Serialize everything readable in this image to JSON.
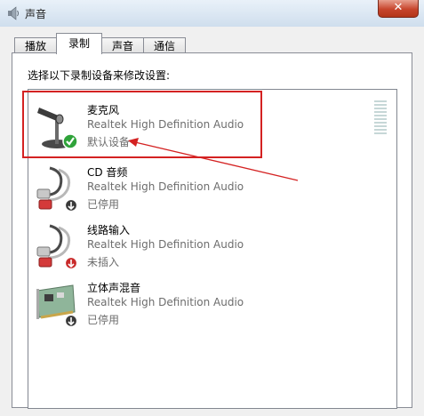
{
  "window": {
    "title": "声音",
    "close_label": "✕"
  },
  "tabs": [
    {
      "label": "播放",
      "active": false
    },
    {
      "label": "录制",
      "active": true
    },
    {
      "label": "声音",
      "active": false
    },
    {
      "label": "通信",
      "active": false
    }
  ],
  "instruction": "选择以下录制设备来修改设置:",
  "devices": [
    {
      "name": "麦克风",
      "driver": "Realtek High Definition Audio",
      "status": "默认设备",
      "icon": "microphone-icon",
      "badge": "default-check-icon"
    },
    {
      "name": "CD 音频",
      "driver": "Realtek High Definition Audio",
      "status": "已停用",
      "icon": "audio-jack-icon",
      "badge": "disabled-arrow-icon"
    },
    {
      "name": "线路输入",
      "driver": "Realtek High Definition Audio",
      "status": "未插入",
      "icon": "audio-jack-icon",
      "badge": "unplugged-arrow-icon"
    },
    {
      "name": "立体声混音",
      "driver": "Realtek High Definition Audio",
      "status": "已停用",
      "icon": "sound-card-icon",
      "badge": "disabled-arrow-icon"
    }
  ],
  "colors": {
    "annotation": "#d42222",
    "default_check": "#2fa33a",
    "unplugged_badge": "#c92b2b"
  }
}
